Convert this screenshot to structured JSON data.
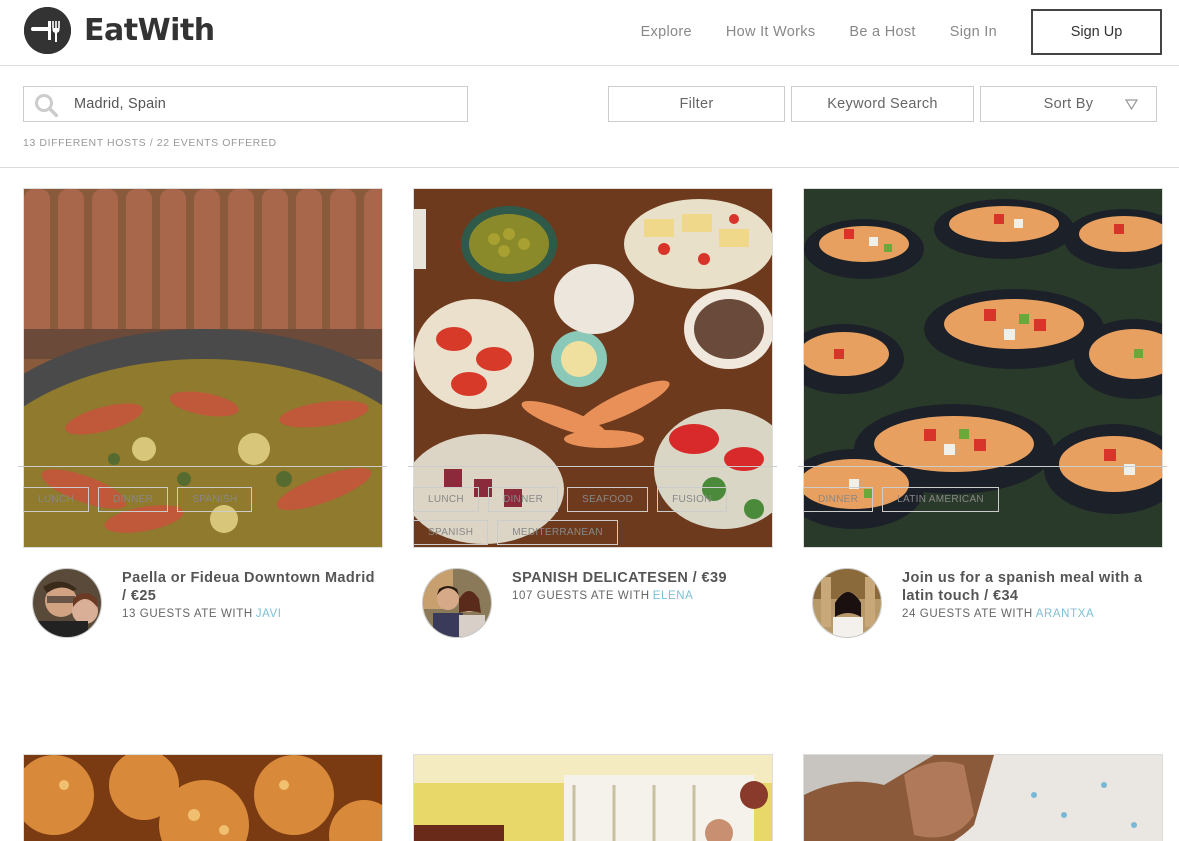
{
  "header": {
    "logo_text": "EatWith",
    "nav": [
      "Explore",
      "How It Works",
      "Be a Host",
      "Sign In"
    ],
    "signup_label": "Sign Up"
  },
  "search": {
    "value": "Madrid, Spain",
    "filter_label": "Filter",
    "keyword_label": "Keyword Search",
    "sort_label": "Sort By",
    "results_summary": "13 DIFFERENT HOSTS / 22 EVENTS OFFERED"
  },
  "cards": [
    {
      "title": "Paella or Fideua Downtown Madrid / €25",
      "guests_prefix": "13 GUESTS ATE WITH",
      "host": "JAVI",
      "tags": [
        "LUNCH",
        "DINNER",
        "SPANISH"
      ]
    },
    {
      "title": "SPANISH DELICATESEN / €39",
      "guests_prefix": "107 GUESTS ATE WITH",
      "host": "ELENA",
      "tags": [
        "LUNCH",
        "DINNER",
        "SEAFOOD",
        "FUSION",
        "SPANISH",
        "MEDITERRANEAN"
      ]
    },
    {
      "title": "Join us for a spanish meal with a latin touch / €34",
      "guests_prefix": "24 GUESTS ATE WITH",
      "host": "ARANTXA",
      "tags": [
        "DINNER",
        "LATIN AMERICAN"
      ]
    }
  ],
  "colors": {
    "accent": "#7cc0d8",
    "text": "#555555",
    "border": "#cccccc"
  }
}
